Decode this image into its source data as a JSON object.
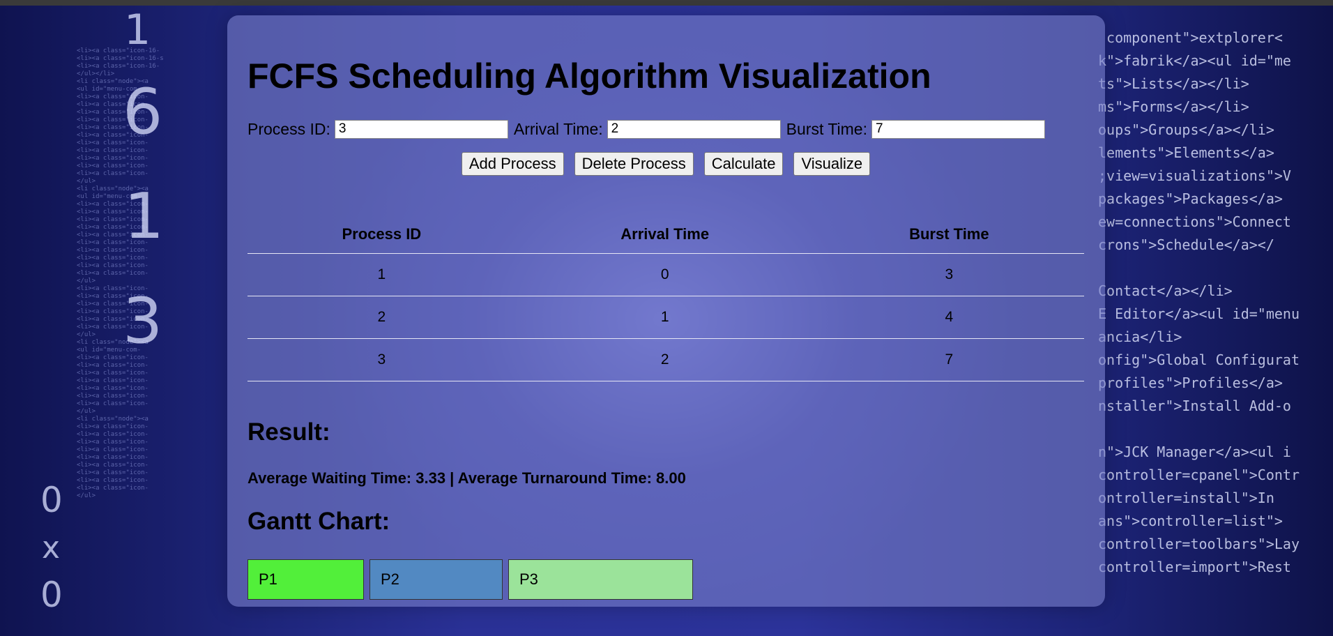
{
  "page": {
    "title": "FCFS Scheduling Algorithm Visualization"
  },
  "form": {
    "process_id_label": "Process ID:",
    "process_id_value": "3",
    "arrival_time_label": "Arrival Time:",
    "arrival_time_value": "2",
    "burst_time_label": "Burst Time:",
    "burst_time_value": "7"
  },
  "buttons": {
    "add_process": "Add Process",
    "delete_process": "Delete Process",
    "calculate": "Calculate",
    "visualize": "Visualize"
  },
  "table": {
    "headers": [
      "Process ID",
      "Arrival Time",
      "Burst Time"
    ],
    "rows": [
      [
        "1",
        "0",
        "3"
      ],
      [
        "2",
        "1",
        "4"
      ],
      [
        "3",
        "2",
        "7"
      ]
    ]
  },
  "result": {
    "heading": "Result:",
    "summary": "Average Waiting Time: 3.33 | Average Turnaround Time: 8.00"
  },
  "gantt": {
    "heading": "Gantt Chart:",
    "blocks": [
      {
        "label": "P1",
        "color": "#52ef3a",
        "burst": 3
      },
      {
        "label": "P2",
        "color": "#5289c2",
        "burst": 4
      },
      {
        "label": "P3",
        "color": "#9be39a",
        "burst": 7
      }
    ]
  }
}
